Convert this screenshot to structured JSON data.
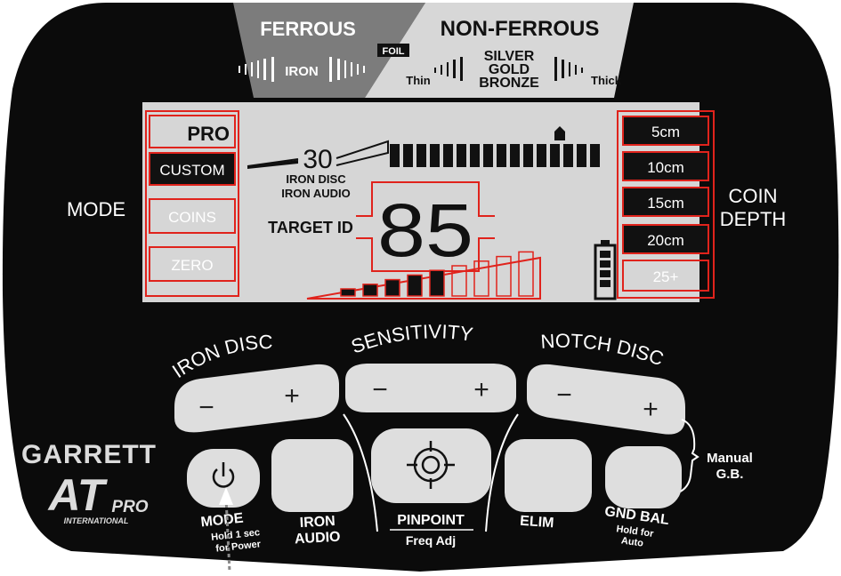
{
  "colors": {
    "panel": "#0b0b0b",
    "lcd": "#d6d6d6",
    "accent": "#e0231c",
    "button": "#dedede",
    "lcd_segment": "#111111"
  },
  "top_scale": {
    "ferrous": "FERROUS",
    "non_ferrous": "NON-FERROUS",
    "foil": "FOIL",
    "iron": "IRON",
    "thin": "Thin",
    "silver": "SILVER",
    "gold": "GOLD",
    "bronze": "BRONZE",
    "thick": "Thick",
    "ticks": [
      "10",
      "20",
      "30",
      "40",
      "50",
      "60",
      "70",
      "80",
      "90"
    ]
  },
  "mode": {
    "label": "MODE",
    "items": [
      {
        "label": "PRO",
        "state": "active"
      },
      {
        "label": "CUSTOM",
        "state": "selected"
      },
      {
        "label": "COINS",
        "state": "inactive"
      },
      {
        "label": "ZERO",
        "state": "inactive"
      }
    ]
  },
  "coin_depth": {
    "label_line1": "COIN",
    "label_line2": "DEPTH",
    "items": [
      {
        "label": "5cm",
        "state": "on"
      },
      {
        "label": "10cm",
        "state": "on"
      },
      {
        "label": "15cm",
        "state": "on"
      },
      {
        "label": "20cm",
        "state": "on"
      },
      {
        "label": "25+",
        "state": "off"
      }
    ]
  },
  "lcd": {
    "iron_disc_value": "30",
    "iron_disc_label": "IRON DISC",
    "iron_audio_label": "IRON AUDIO",
    "target_id_label": "TARGET ID",
    "target_id_value": "85",
    "signal_bars_filled": 5,
    "signal_bars_total": 9,
    "battery_level": 1.0
  },
  "controls": {
    "iron_disc": {
      "title": "IRON DISC",
      "minus": "−",
      "plus": "+"
    },
    "sensitivity": {
      "title": "SENSITIVITY",
      "minus": "−",
      "plus": "+"
    },
    "notch_disc": {
      "title": "NOTCH DISC",
      "minus": "−",
      "plus": "+"
    },
    "manual_gb_line1": "Manual",
    "manual_gb_line2": "G.B."
  },
  "buttons": {
    "mode_power": {
      "label": "MODE",
      "sub1": "Hold 1 sec",
      "sub2": "for Power"
    },
    "iron_audio": {
      "label1": "IRON",
      "label2": "AUDIO"
    },
    "pinpoint": {
      "label": "PINPOINT",
      "sub": "Freq Adj"
    },
    "elim": {
      "label": "ELIM"
    },
    "gnd_bal": {
      "label": "GND BAL",
      "sub1": "Hold for",
      "sub2": "Auto"
    }
  },
  "brand": {
    "name": "GARRETT",
    "model": "AT",
    "model_suffix": "PRO",
    "region": "INTERNATIONAL"
  }
}
